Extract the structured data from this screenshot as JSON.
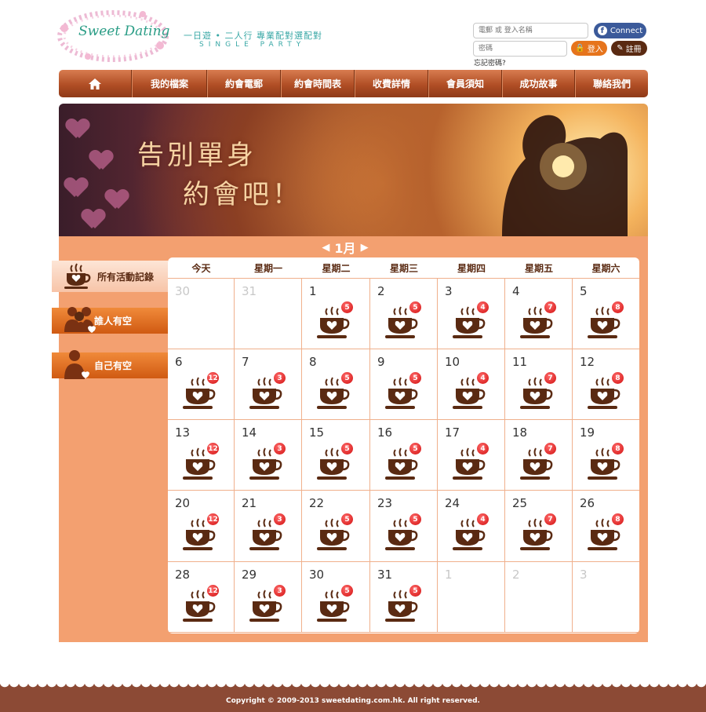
{
  "header": {
    "logo_text": "Sweet Dating",
    "tagline": "一日遊 • 二人行  專業配對選配對",
    "tagline_sub": "SINGLE PARTY"
  },
  "login": {
    "email_placeholder": "電郵 或 登入名稱",
    "password_placeholder": "密碼",
    "facebook_label": "Connect",
    "login_label": "登入",
    "register_label": "註冊",
    "forgot_label": "忘記密碼?"
  },
  "nav": {
    "items": [
      {
        "label": "我的檔案"
      },
      {
        "label": "約會電郵"
      },
      {
        "label": "約會時間表"
      },
      {
        "label": "收費詳情"
      },
      {
        "label": "會員須知"
      },
      {
        "label": "成功故事"
      },
      {
        "label": "聯絡我們"
      }
    ]
  },
  "banner": {
    "line1": "告別單身",
    "line2": "約會吧！"
  },
  "calendar": {
    "month": "1月",
    "weekdays": [
      "今天",
      "星期一",
      "星期二",
      "星期三",
      "星期四",
      "星期五",
      "星期六"
    ],
    "days": [
      {
        "day": "30",
        "dim": true,
        "count": null
      },
      {
        "day": "31",
        "dim": true,
        "count": null
      },
      {
        "day": "1",
        "dim": false,
        "count": "5"
      },
      {
        "day": "2",
        "dim": false,
        "count": "5"
      },
      {
        "day": "3",
        "dim": false,
        "count": "4"
      },
      {
        "day": "4",
        "dim": false,
        "count": "7"
      },
      {
        "day": "5",
        "dim": false,
        "count": "8"
      },
      {
        "day": "6",
        "dim": false,
        "count": "12"
      },
      {
        "day": "7",
        "dim": false,
        "count": "3"
      },
      {
        "day": "8",
        "dim": false,
        "count": "5"
      },
      {
        "day": "9",
        "dim": false,
        "count": "5"
      },
      {
        "day": "10",
        "dim": false,
        "count": "4"
      },
      {
        "day": "11",
        "dim": false,
        "count": "7"
      },
      {
        "day": "12",
        "dim": false,
        "count": "8"
      },
      {
        "day": "13",
        "dim": false,
        "count": "12"
      },
      {
        "day": "14",
        "dim": false,
        "count": "3"
      },
      {
        "day": "15",
        "dim": false,
        "count": "5"
      },
      {
        "day": "16",
        "dim": false,
        "count": "5"
      },
      {
        "day": "17",
        "dim": false,
        "count": "4"
      },
      {
        "day": "18",
        "dim": false,
        "count": "7"
      },
      {
        "day": "19",
        "dim": false,
        "count": "8"
      },
      {
        "day": "20",
        "dim": false,
        "count": "12"
      },
      {
        "day": "21",
        "dim": false,
        "count": "3"
      },
      {
        "day": "22",
        "dim": false,
        "count": "5"
      },
      {
        "day": "23",
        "dim": false,
        "count": "5"
      },
      {
        "day": "24",
        "dim": false,
        "count": "4"
      },
      {
        "day": "25",
        "dim": false,
        "count": "7"
      },
      {
        "day": "26",
        "dim": false,
        "count": "8"
      },
      {
        "day": "28",
        "dim": false,
        "count": "12"
      },
      {
        "day": "29",
        "dim": false,
        "count": "3"
      },
      {
        "day": "30",
        "dim": false,
        "count": "5"
      },
      {
        "day": "31",
        "dim": false,
        "count": "5"
      },
      {
        "day": "1",
        "dim": true,
        "count": null
      },
      {
        "day": "2",
        "dim": true,
        "count": null
      },
      {
        "day": "3",
        "dim": true,
        "count": null
      }
    ]
  },
  "sidebar": {
    "tabs": [
      {
        "label": "所有活動記錄"
      },
      {
        "label": "誰人有空"
      },
      {
        "label": "自己有空"
      }
    ]
  },
  "footer": {
    "copyright": "Copyright © 2009-2013 sweetdating.com.hk. All right reserved."
  },
  "colors": {
    "nav_brown": "#b04e25",
    "panel_orange": "#f3a070",
    "badge_red": "#d10f0f",
    "cup_brown": "#5a2a12"
  }
}
